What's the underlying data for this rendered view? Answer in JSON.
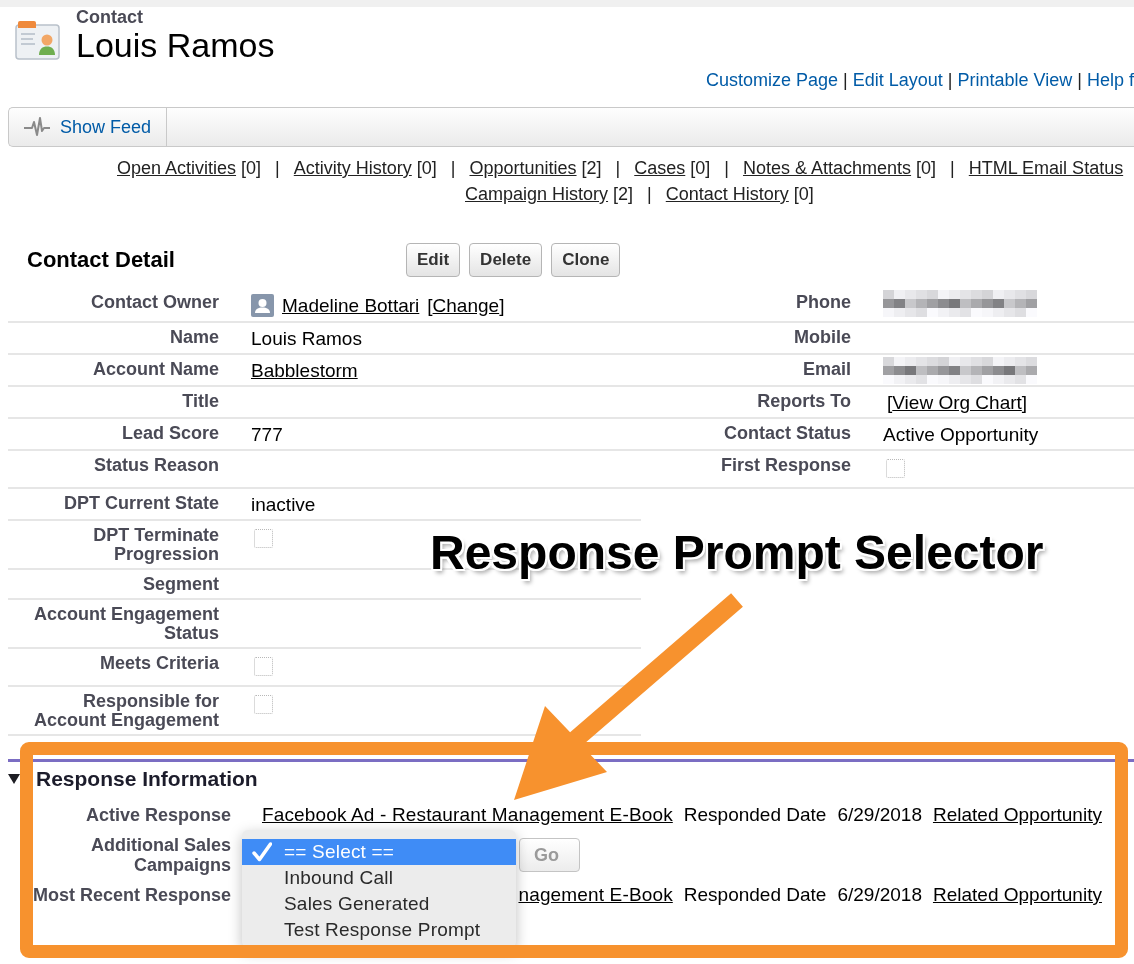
{
  "header": {
    "object_type": "Contact",
    "title": "Louis Ramos"
  },
  "page_links": [
    {
      "kind": "link",
      "label": "Customize Page"
    },
    {
      "kind": "separator",
      "text": "|"
    },
    {
      "kind": "link",
      "label": "Edit Layout"
    },
    {
      "kind": "separator",
      "text": "|"
    },
    {
      "kind": "link",
      "label": "Printable View"
    },
    {
      "kind": "separator",
      "text": "|"
    },
    {
      "kind": "link",
      "label": "Help f"
    }
  ],
  "feed_bar": {
    "button": "Show Feed"
  },
  "related_lists": [
    [
      {
        "kind": "link",
        "label": "Open Activities",
        "count": "[0]"
      },
      {
        "kind": "separator",
        "text": "|"
      },
      {
        "kind": "link",
        "label": "Activity History",
        "count": "[0]"
      },
      {
        "kind": "separator",
        "text": "|"
      },
      {
        "kind": "link",
        "label": "Opportunities",
        "count": "[2]"
      },
      {
        "kind": "separator",
        "text": "|"
      },
      {
        "kind": "link",
        "label": "Cases",
        "count": "[0]"
      },
      {
        "kind": "separator",
        "text": "|"
      },
      {
        "kind": "link",
        "label": "Notes & Attachments",
        "count": "[0]"
      },
      {
        "kind": "separator",
        "text": "|"
      },
      {
        "kind": "link",
        "label": "HTML Email Status"
      }
    ],
    [
      {
        "kind": "link",
        "label": "Campaign History",
        "count": "[2]"
      },
      {
        "kind": "separator",
        "text": "|"
      },
      {
        "kind": "link",
        "label": "Contact History",
        "count": "[0]"
      }
    ]
  ],
  "contact_detail": {
    "title": "Contact Detail",
    "buttons": [
      "Edit",
      "Delete",
      "Clone"
    ],
    "left_fields": [
      {
        "label": "Contact Owner",
        "kind": "owner",
        "value": "Madeline Bottari",
        "action": {
          "open": "[",
          "label": "Change",
          "close": "]"
        }
      },
      {
        "label": "Name",
        "kind": "text",
        "value": "Louis Ramos"
      },
      {
        "label": "Account Name",
        "kind": "link",
        "value": "Babblestorm"
      },
      {
        "label": "Title",
        "kind": "text"
      },
      {
        "label": "Lead Score",
        "kind": "text",
        "value": "777"
      },
      {
        "label": "Status Reason",
        "kind": "text"
      },
      {
        "label": "DPT Current State",
        "kind": "text",
        "value": "inactive"
      },
      {
        "label": "DPT Terminate Progression",
        "kind": "checkbox",
        "checked": false
      },
      {
        "label": "Segment",
        "kind": "text"
      },
      {
        "label": "Account Engagement Status",
        "kind": "text"
      },
      {
        "label": "Meets Criteria",
        "kind": "checkbox",
        "checked": false
      },
      {
        "label": "Responsible for Account Engagement",
        "kind": "checkbox",
        "checked": false
      }
    ],
    "right_fields": [
      {
        "label": "Phone",
        "kind": "blurred"
      },
      {
        "label": "Mobile",
        "kind": "text"
      },
      {
        "label": "Email",
        "kind": "blurred"
      },
      {
        "label": "Reports To",
        "kind": "bracket_link",
        "open": "[",
        "value": "View Org Chart",
        "close": "]"
      },
      {
        "label": "Contact Status",
        "kind": "text",
        "value": "Active Opportunity"
      },
      {
        "label": "First Response",
        "kind": "checkbox",
        "checked": false
      }
    ]
  },
  "response_information": {
    "title": "Response Information",
    "expanded": true,
    "rows": [
      {
        "label": "Active Response",
        "kind": "response",
        "name": "Facebook Ad - Restaurant Management E-Book",
        "date_label": "Responded Date",
        "date": "6/29/2018",
        "link": "Related Opportunity"
      },
      {
        "label": "Additional Sales Campaigns",
        "kind": "campaign_select",
        "options": [
          {
            "label": "== Select ==",
            "selected": true
          },
          {
            "label": "Inbound Call",
            "selected": false
          },
          {
            "label": "Sales Generated",
            "selected": false
          },
          {
            "label": "Test Response Prompt",
            "selected": false
          }
        ],
        "button": {
          "label": "Go",
          "disabled": true
        }
      },
      {
        "label": "Most Recent Response",
        "kind": "response",
        "name": "nagement E-Book",
        "date_label": "Responded Date",
        "date": "6/29/2018",
        "link": "Related Opportunity"
      }
    ]
  },
  "annotation": {
    "text": "Response Prompt Selector"
  }
}
